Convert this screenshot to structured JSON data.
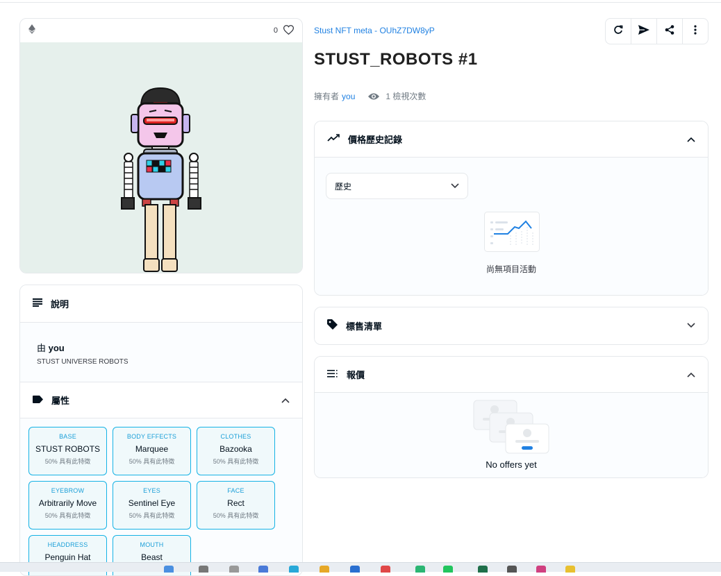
{
  "image_card": {
    "chain_icon": "ethereum-icon",
    "favorites_count": "0",
    "favorite_icon": "heart-icon"
  },
  "description_panel": {
    "title": "說明",
    "creator_prefix": "由",
    "creator": "you",
    "text": "STUST UNIVERSE ROBOTS"
  },
  "attributes_panel": {
    "title": "屬性",
    "traits": [
      {
        "type": "BASE",
        "value": "STUST ROBOTS",
        "rarity": "50% 具有此特徵"
      },
      {
        "type": "BODY EFFECTS",
        "value": "Marquee",
        "rarity": "50% 具有此特徵"
      },
      {
        "type": "CLOTHES",
        "value": "Bazooka",
        "rarity": "50% 具有此特徵"
      },
      {
        "type": "EYEBROW",
        "value": "Arbitrarily Move",
        "rarity": "50% 具有此特徵"
      },
      {
        "type": "EYES",
        "value": "Sentinel Eye",
        "rarity": "50% 具有此特徵"
      },
      {
        "type": "FACE",
        "value": "Rect",
        "rarity": "50% 具有此特徵"
      },
      {
        "type": "HEADDRESS",
        "value": "Penguin Hat",
        "rarity": ""
      },
      {
        "type": "MOUTH",
        "value": "Beast",
        "rarity": ""
      }
    ]
  },
  "header": {
    "collection": "Stust NFT meta - OUhZ7DW8yP",
    "title": "STUST_ROBOTS #1",
    "owner_prefix": "擁有者",
    "owner": "you",
    "views": "1 檢視次數"
  },
  "actions": [
    {
      "name": "refresh-button",
      "icon": "refresh-icon"
    },
    {
      "name": "transfer-button",
      "icon": "send-icon"
    },
    {
      "name": "share-button",
      "icon": "share-icon"
    },
    {
      "name": "more-button",
      "icon": "more-vertical-icon"
    }
  ],
  "price_history": {
    "title": "價格歷史記錄",
    "filter_value": "歷史",
    "empty_text": "尚無項目活動"
  },
  "listings": {
    "title": "標售清單"
  },
  "offers": {
    "title": "報價",
    "empty_text": "No offers yet"
  },
  "colors": {
    "link": "#2081e2",
    "trait_border": "#15b2e5",
    "trait_bg": "#f0f9fb",
    "art_bg": "#e6f0ec"
  }
}
